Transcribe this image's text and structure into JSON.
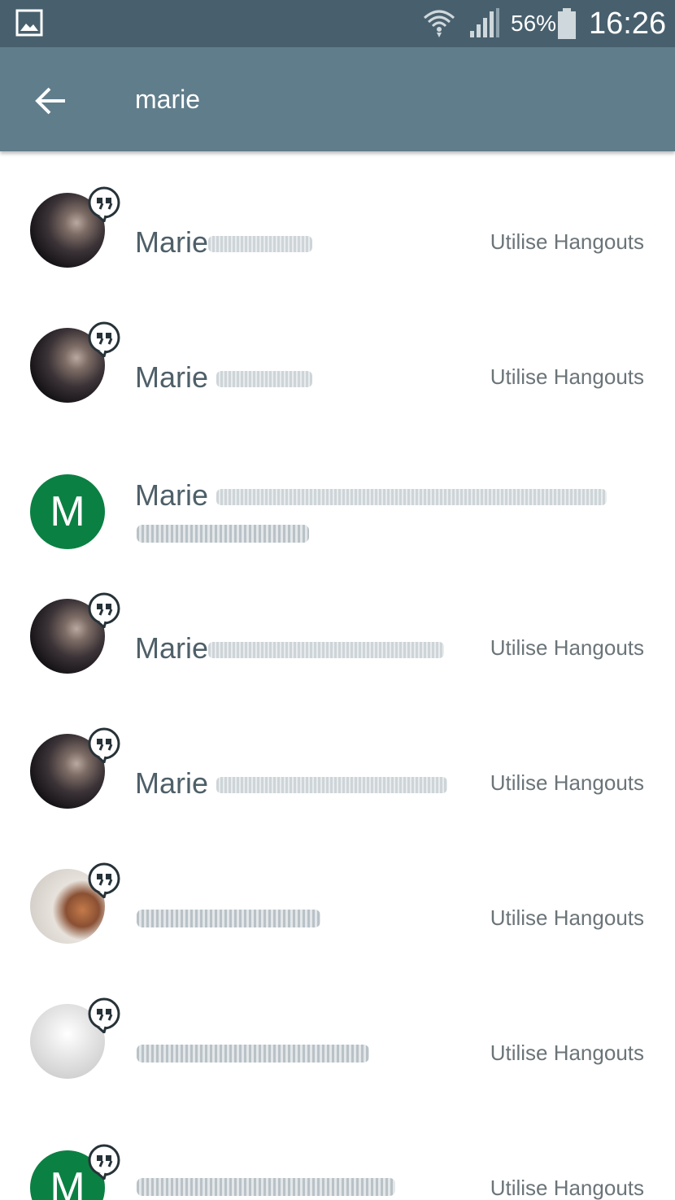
{
  "status_bar": {
    "battery_percent": "56%",
    "time": "16:26",
    "icons": [
      "gallery-icon",
      "wifi-icon",
      "signal-icon",
      "battery-icon"
    ]
  },
  "app_bar": {
    "search_query": "marie",
    "back_icon": "arrow-back-icon"
  },
  "colors": {
    "status_bar": "#48606e",
    "app_bar": "#607d8b",
    "letter_avatar": "#0b8043"
  },
  "contacts": [
    {
      "name": "Marie",
      "avatar_letter": "",
      "status": "Utilise Hangouts"
    },
    {
      "name": "Marie",
      "avatar_letter": "",
      "status": "Utilise Hangouts"
    },
    {
      "name": "Marie",
      "avatar_letter": "M",
      "status": ""
    },
    {
      "name": "Marie",
      "avatar_letter": "",
      "status": "Utilise Hangouts"
    },
    {
      "name": "Marie",
      "avatar_letter": "",
      "status": "Utilise Hangouts"
    },
    {
      "name": "",
      "avatar_letter": "",
      "status": "Utilise Hangouts"
    },
    {
      "name": "",
      "avatar_letter": "",
      "status": "Utilise Hangouts"
    },
    {
      "name": "",
      "avatar_letter": "M",
      "status": "Utilise Hangouts"
    }
  ]
}
